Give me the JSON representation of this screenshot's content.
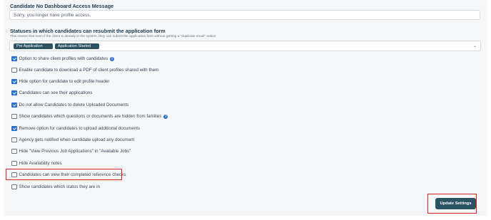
{
  "no_access": {
    "title": "Candidate No Dashboard Access Message",
    "value": "Sorry, you longer have profile access."
  },
  "statuses": {
    "title": "Statuses in which candidates can resubmit the application form",
    "note": "This means that even if the client is already in the system, they can submit the application form without getting a \"duplicate email\" notice",
    "selected": [
      "Pre Application",
      "Application Started"
    ],
    "caret": "⌄"
  },
  "options": [
    {
      "label": "Option to share client profiles with candidates",
      "checked": true,
      "info": true
    },
    {
      "label": "Enable candidate to download a PDF of client profiles shared with them",
      "checked": false,
      "info": false
    },
    {
      "label": "Hide option for candidate to edit profile header",
      "checked": true,
      "info": false
    },
    {
      "label": "Candidates can see their applications",
      "checked": true,
      "info": false
    },
    {
      "label": "Do not allow Candidates to delete Uploaded Documents",
      "checked": true,
      "info": false
    },
    {
      "label": "Show candidates which questions or documents are hidden from families",
      "checked": false,
      "info": true
    },
    {
      "label": "Remove option for candidates to upload additional documents",
      "checked": true,
      "info": false
    },
    {
      "label": "Agency gets notified when candidate upload any document",
      "checked": false,
      "info": false
    },
    {
      "label": "Hide \"View Previous Job Applications\" in \"Available Jobs\"",
      "checked": false,
      "info": false
    },
    {
      "label": "Hide Availability notes",
      "checked": false,
      "info": false
    },
    {
      "label": "Candidates can view their completed reference checks",
      "checked": false,
      "info": false
    },
    {
      "label": "Show candidates which status they are in",
      "checked": false,
      "info": false
    }
  ],
  "info_glyph": "i",
  "update_button": "Update Settings",
  "colors": {
    "accent": "#2c5364",
    "check": "#2f6fc9",
    "highlight": "#e02020"
  }
}
